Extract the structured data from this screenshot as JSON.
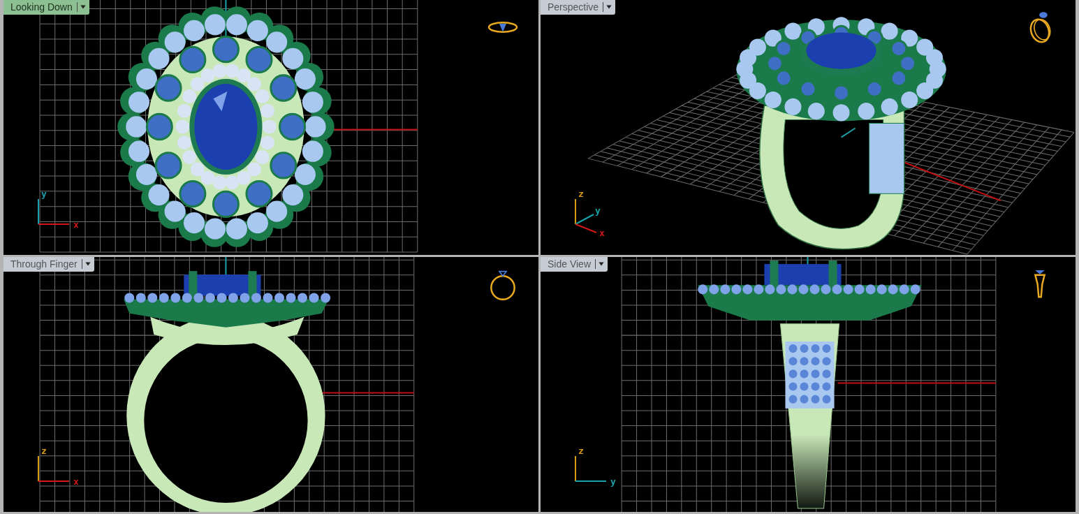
{
  "viewports": [
    {
      "title": "Looking Down",
      "selected": true,
      "kind": "top",
      "axes": [
        {
          "label": "y",
          "kind": "up",
          "color": "#1aa0a8"
        },
        {
          "label": "x",
          "kind": "right",
          "color": "#d01818"
        }
      ]
    },
    {
      "title": "Perspective",
      "selected": false,
      "kind": "perspective",
      "axes": [
        {
          "label": "z",
          "kind": "up",
          "color": "#d89a10"
        },
        {
          "label": "y",
          "kind": "diag-up",
          "color": "#1aa0a8"
        },
        {
          "label": "x",
          "kind": "diag-down",
          "color": "#d01818"
        }
      ]
    },
    {
      "title": "Through Finger",
      "selected": false,
      "kind": "front",
      "axes": [
        {
          "label": "z",
          "kind": "up",
          "color": "#d89a10"
        },
        {
          "label": "x",
          "kind": "right",
          "color": "#d01818"
        }
      ]
    },
    {
      "title": "Side View",
      "selected": false,
      "kind": "side",
      "axes": [
        {
          "label": "z",
          "kind": "up",
          "color": "#d89a10"
        },
        {
          "label": "y",
          "kind": "right",
          "color": "#1aa0a8"
        }
      ]
    }
  ]
}
